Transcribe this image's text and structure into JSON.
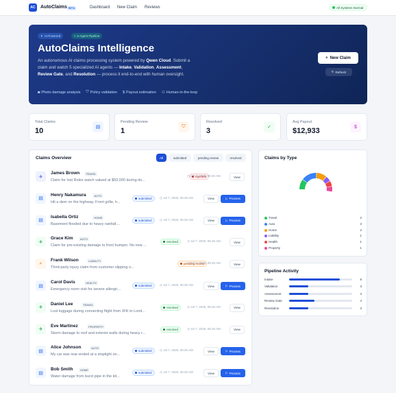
{
  "header": {
    "logo": "AC",
    "brand": "AutoClaims",
    "beta": "BETA",
    "nav": [
      "Dashboard",
      "New Claim",
      "Reviews"
    ],
    "status": "All Systems Normal"
  },
  "hero": {
    "pill_a": "AI-Powered",
    "pill_b": "5-Agent Pipeline",
    "title": "AutoClaims Intelligence",
    "desc_1": "An autonomous AI claims processing system powered by ",
    "desc_b1": "Qwen Cloud",
    "desc_2": ". Submit a claim and watch 5 specialized AI agents — ",
    "desc_b2": "Intake",
    "desc_3": ", ",
    "desc_b3": "Validation",
    "desc_4": ", ",
    "desc_b4": "Assessment",
    "desc_5": ", ",
    "desc_b5": "Review Gate",
    "desc_6": ", and ",
    "desc_b6": "Resolution",
    "desc_7": " — process it end-to-end with human oversight.",
    "features": [
      "Photo damage analysis",
      "Policy validation",
      "Payout estimation",
      "Human-in-the-loop"
    ],
    "new_claim": "New Claim",
    "refresh": "Refresh"
  },
  "stats": [
    {
      "label": "Total Claims",
      "value": "10"
    },
    {
      "label": "Pending Review",
      "value": "1"
    },
    {
      "label": "Resolved",
      "value": "3"
    },
    {
      "label": "Avg Payout",
      "value": "$12,933"
    }
  ],
  "claims_panel": {
    "title": "Claims Overview",
    "filters": [
      "All",
      "submitted",
      "pending review",
      "resolved"
    ],
    "view_label": "View",
    "process_label": "Process"
  },
  "claims": [
    {
      "name": "James Brown",
      "type": "TRAVEL",
      "desc": "Claim for lost Rolex watch valued at $50,000 during do...",
      "status": "rejected",
      "date": "Jul 7, 2026, 05:26 AM"
    },
    {
      "name": "Henry Nakamura",
      "type": "AUTO",
      "desc": "Hit a deer on the highway. Front grille, h...",
      "status": "submitted",
      "date": "Jul 7, 2026, 05:26 AM"
    },
    {
      "name": "Isabella Ortiz",
      "type": "HOME",
      "desc": "Basement flooded due to heavy rainfall....",
      "status": "submitted",
      "date": "Jul 7, 2026, 05:26 AM"
    },
    {
      "name": "Grace Kim",
      "type": "AUTO",
      "desc": "Claim for pre-existing damage to front bumper. No new ...",
      "status": "resolved",
      "date": "Jul 7, 2026, 05:26 AM"
    },
    {
      "name": "Frank Wilson",
      "type": "LIABILITY",
      "desc": "Third-party injury claim from customer slipping o...",
      "status": "pending review",
      "date": "Jul 7, 2026, 05:26 AM"
    },
    {
      "name": "Carol Davis",
      "type": "HEALTH",
      "desc": "Emergency room visit for severe allergic...",
      "status": "submitted",
      "date": "Jul 7, 2026, 05:26 AM"
    },
    {
      "name": "Daniel Lee",
      "type": "TRAVEL",
      "desc": "Lost luggage during connecting flight from JFK to Lond...",
      "status": "resolved",
      "date": "Jul 7, 2026, 05:26 AM"
    },
    {
      "name": "Eve Martinez",
      "type": "PROPERTY",
      "desc": "Storm damage to roof and exterior walls during heavy r...",
      "status": "resolved",
      "date": "Jul 7, 2026, 05:26 AM"
    },
    {
      "name": "Alice Johnson",
      "type": "AUTO",
      "desc": "My car was rear-ended at a stoplight on...",
      "status": "submitted",
      "date": "Jul 7, 2026, 05:26 AM"
    },
    {
      "name": "Bob Smith",
      "type": "HOME",
      "desc": "Water damage from burst pipe in the kit...",
      "status": "submitted",
      "date": "Jul 7, 2026, 05:26 AM"
    }
  ],
  "type_panel": {
    "title": "Claims by Type",
    "items": [
      {
        "label": "Travel",
        "value": 2,
        "color": "#22c55e"
      },
      {
        "label": "Auto",
        "value": 3,
        "color": "#3b82f6"
      },
      {
        "label": "Home",
        "value": 2,
        "color": "#f59e0b"
      },
      {
        "label": "Liability",
        "value": 1,
        "color": "#8b5cf6"
      },
      {
        "label": "Health",
        "value": 1,
        "color": "#ef4444"
      },
      {
        "label": "Property",
        "value": 1,
        "color": "#ec4899"
      }
    ]
  },
  "pipeline_panel": {
    "title": "Pipeline Activity",
    "max": 10,
    "items": [
      {
        "label": "Intake",
        "value": 8
      },
      {
        "label": "Validation",
        "value": 3
      },
      {
        "label": "Assessment",
        "value": 3
      },
      {
        "label": "Review Gate",
        "value": 4
      },
      {
        "label": "Resolution",
        "value": 3
      }
    ]
  }
}
